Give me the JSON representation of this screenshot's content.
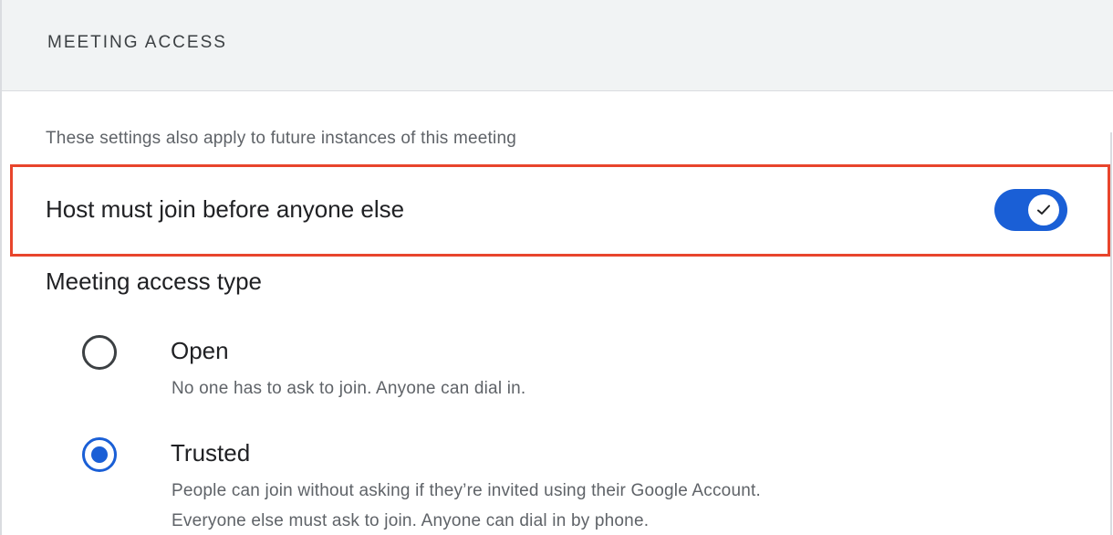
{
  "section": {
    "title": "MEETING ACCESS"
  },
  "note": "These settings also apply to future instances of this meeting",
  "host_setting": {
    "label": "Host must join before anyone else",
    "enabled": true,
    "toggle_icon": "check-icon"
  },
  "access_type": {
    "title": "Meeting access type",
    "selected": "Trusted",
    "options": [
      {
        "label": "Open",
        "description": "No one has to ask to join. Anyone can dial in."
      },
      {
        "label": "Trusted",
        "description_line1": "People can join without asking if they’re invited using their Google Account.",
        "description_line2": "Everyone else must ask to join. Anyone can dial in by phone."
      }
    ]
  },
  "colors": {
    "accent": "#1a5fd6",
    "highlight": "#e8452c",
    "header_bg": "#f1f3f4"
  }
}
